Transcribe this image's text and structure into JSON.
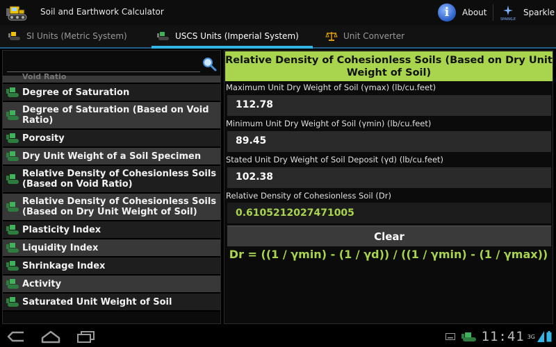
{
  "app": {
    "title": "Soil and Earthwork Calculator"
  },
  "header": {
    "about_label": "About",
    "sparkle_label": "Sparkle",
    "sparkle_logo_text": "SPARKLE"
  },
  "tabs": [
    {
      "label": "SI Units (Metric System)",
      "active": false
    },
    {
      "label": "USCS Units (Imperial System)",
      "active": true
    },
    {
      "label": "Unit Converter",
      "active": false
    }
  ],
  "search": {
    "value": "",
    "placeholder": ""
  },
  "list": {
    "partial_top": "Void Ratio",
    "items": [
      "Degree of Saturation",
      "Degree of Saturation (Based on Void Ratio)",
      "Porosity",
      "Dry Unit Weight of a Soil Specimen",
      "Relative Density of Cohesionless Soils (Based on Void Ratio)",
      "Relative Density of Cohesionless Soils (Based on Dry Unit Weight of Soil)",
      "Plasticity Index",
      "Liquidity Index",
      "Shrinkage Index",
      "Activity",
      "Saturated Unit Weight of Soil"
    ]
  },
  "detail": {
    "title": "Relative Density of Cohesionless Soils (Based on Dry Unit Weight of Soil)",
    "fields": [
      {
        "label": "Maximum Unit Dry Weight of Soil (γmax) (lb/cu.feet)",
        "value": "112.78"
      },
      {
        "label": "Minimum Unit Dry Weight of Soil (γmin) (lb/cu.feet)",
        "value": "89.45"
      },
      {
        "label": "Stated Unit Dry Weight of Soil Deposit (γd) (lb/cu.feet)",
        "value": "102.38"
      }
    ],
    "result_label": "Relative Density of Cohesionless Soil (Dr)",
    "result_value": "0.6105212027471005",
    "clear_label": "Clear",
    "formula": "Dr = ((1 / γmin) - (1 / γd)) / ((1 / γmin) - (1 / γmax))"
  },
  "status": {
    "time": "11:41",
    "network": "3G"
  },
  "colors": {
    "accent_green": "#a8d44e",
    "tab_indicator": "#33b5e5"
  }
}
